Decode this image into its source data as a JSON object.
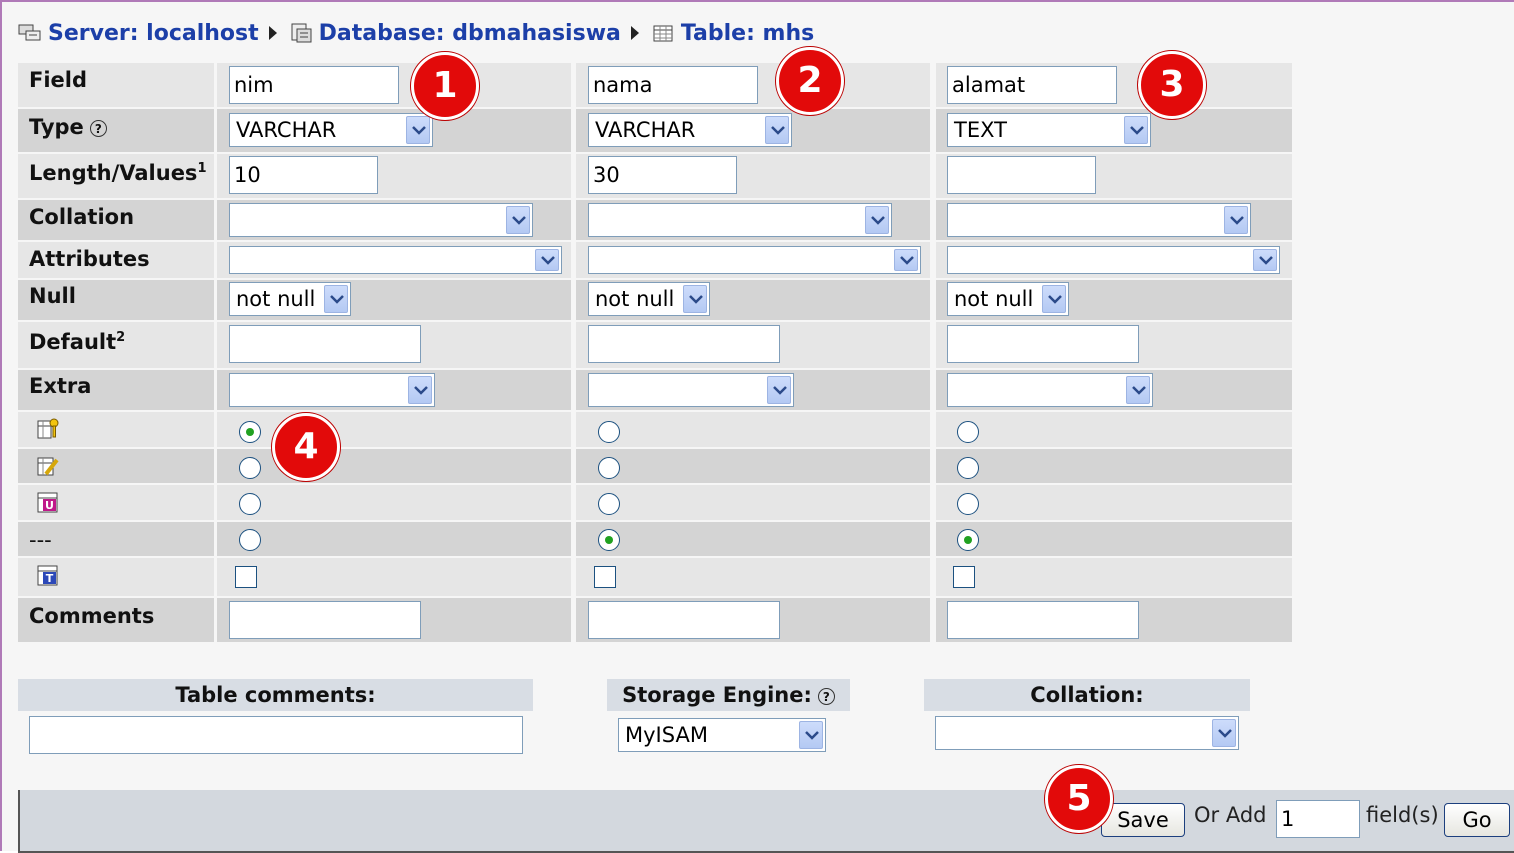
{
  "breadcrumb": {
    "server": "Server: localhost",
    "database": "Database: dbmahasiswa",
    "table": "Table: mhs"
  },
  "labels": {
    "field": "Field",
    "type": "Type",
    "length": "Length/Values",
    "length_sup": "1",
    "collation": "Collation",
    "attributes": "Attributes",
    "null": "Null",
    "default": "Default",
    "default_sup": "2",
    "extra": "Extra",
    "none": "---",
    "comments": "Comments"
  },
  "columns": [
    {
      "field": "nim",
      "type": "VARCHAR",
      "length": "10",
      "collation": "",
      "attributes": "",
      "null": "not null",
      "default": "",
      "extra": "",
      "index": "primary",
      "fulltext": false,
      "comments": ""
    },
    {
      "field": "nama",
      "type": "VARCHAR",
      "length": "30",
      "collation": "",
      "attributes": "",
      "null": "not null",
      "default": "",
      "extra": "",
      "index": "none",
      "fulltext": false,
      "comments": ""
    },
    {
      "field": "alamat",
      "type": "TEXT",
      "length": "",
      "collation": "",
      "attributes": "",
      "null": "not null",
      "default": "",
      "extra": "",
      "index": "none",
      "fulltext": false,
      "comments": ""
    }
  ],
  "index_icons": [
    "primary-key-icon",
    "index-icon",
    "unique-icon",
    "none",
    "fulltext-icon"
  ],
  "annotations": [
    "1",
    "2",
    "3",
    "4",
    "5"
  ],
  "table_options": {
    "table_comments_label": "Table comments:",
    "table_comments_value": "",
    "storage_engine_label": "Storage Engine:",
    "storage_engine_value": "MyISAM",
    "collation_label": "Collation:",
    "collation_value": ""
  },
  "footer": {
    "save_label": "Save",
    "or_add_label": "Or Add",
    "add_count": "1",
    "fields_label": "field(s)",
    "go_label": "Go"
  },
  "colors": {
    "link": "#1c3fa8",
    "badge": "#e20a0a",
    "row_light": "#e6e6e6",
    "row_dark": "#d4d4d4"
  }
}
